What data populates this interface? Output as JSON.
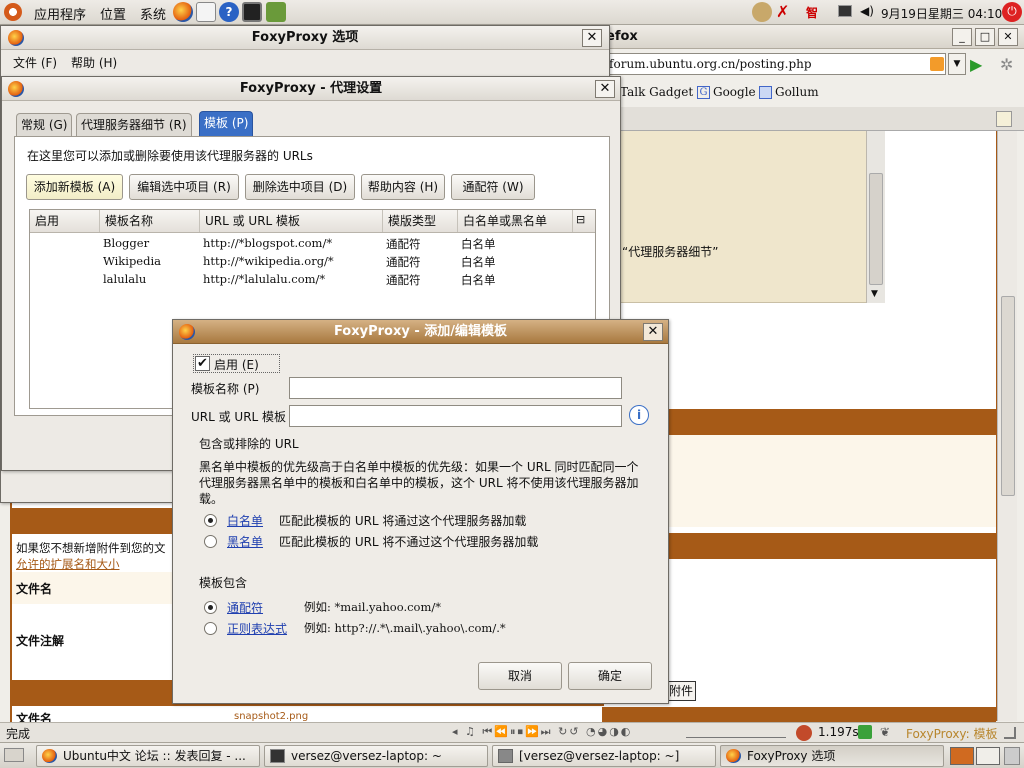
{
  "top_panel": {
    "menus": [
      "应用程序",
      "位置",
      "系统"
    ],
    "clock": "9月19日星期三 04:10",
    "xiaohong": "智"
  },
  "firefox": {
    "title_fragment": "efox",
    "url": "/forum.ubuntu.org.cn/posting.php",
    "bookmarks": [
      "Talk Gadget",
      "Google",
      "Gollum"
    ],
    "quote_text": "“代理服务器细节”"
  },
  "behind_page": {
    "left_note": "如果您不想新增附件到您的文",
    "left_link": "允许的扩展名和大小",
    "file_name_label": "文件名",
    "file_note_label": "文件注解",
    "file_name_label2": "文件名",
    "attach_button_fragment": "附件",
    "snapshot_fragment": "snapshot2.png"
  },
  "options_dialog": {
    "title": "FoxyProxy 选项",
    "menu": [
      "文件 (F)",
      "帮助 (H)"
    ]
  },
  "proxy_dialog": {
    "title": "FoxyProxy - 代理设置",
    "tabs": [
      "常规 (G)",
      "代理服务器细节 (R)",
      "模板 (P)"
    ],
    "description": "在这里您可以添加或删除要使用该代理服务器的 URLs",
    "buttons": [
      "添加新模板 (A)",
      "编辑选中项目 (R)",
      "删除选中项目 (D)",
      "帮助内容 (H)",
      "通配符 (W)"
    ],
    "columns": [
      "启用",
      "模板名称",
      "URL 或 URL 模板",
      "模版类型",
      "白名单或黑名单"
    ],
    "rows": [
      {
        "name": "Blogger",
        "url": "http://*blogspot.com/*",
        "type": "通配符",
        "list": "白名单"
      },
      {
        "name": "Wikipedia",
        "url": "http://*wikipedia.org/*",
        "type": "通配符",
        "list": "白名单"
      },
      {
        "name": "lalulalu",
        "url": "http://*lalulalu.com/*",
        "type": "通配符",
        "list": "白名单"
      }
    ]
  },
  "edit_dialog": {
    "title": "FoxyProxy - 添加/编辑模板",
    "enable_label": "启用 (E)",
    "enabled": true,
    "name_label": "模板名称 (P)",
    "name_value": "",
    "url_label": "URL 或 URL 模板",
    "url_value": "",
    "include_heading": "包含或排除的 URL",
    "explanation": "黑名单中模板的优先级高于白名单中模板的优先级：如果一个 URL 同时匹配同一个代理服务器黑名单中的模板和白名单中的模板，这个 URL 将不使用该代理服务器加载。",
    "whitelist_link": "白名单",
    "whitelist_desc": "匹配此模板的 URL 将通过这个代理服务器加载",
    "blacklist_link": "黑名单",
    "blacklist_desc": "匹配此模板的 URL 将不通过这个代理服务器加载",
    "selected_list": "白名单",
    "pattern_heading": "模板包含",
    "wildcard_link": "通配符",
    "wildcard_example": "例如: *mail.yahoo.com/*",
    "regex_link": "正则表达式",
    "regex_example": "例如: http?://.*\\.mail\\.yahoo\\.com/.*",
    "selected_pattern": "通配符",
    "cancel_label": "取消",
    "ok_label": "确定"
  },
  "status_bar": {
    "left": "完成",
    "timing": "1.197s",
    "foxyproxy": "FoxyProxy: 模板"
  },
  "taskbar": {
    "items": [
      "Ubuntu中文 论坛 :: 发表回复 - ...",
      "versez@versez-laptop: ~",
      "[versez@versez-laptop: ~]",
      "FoxyProxy 选项"
    ]
  },
  "colors": {
    "brown_bar": "#a65a17",
    "link": "#2040b0",
    "beige": "#efe6cc"
  }
}
